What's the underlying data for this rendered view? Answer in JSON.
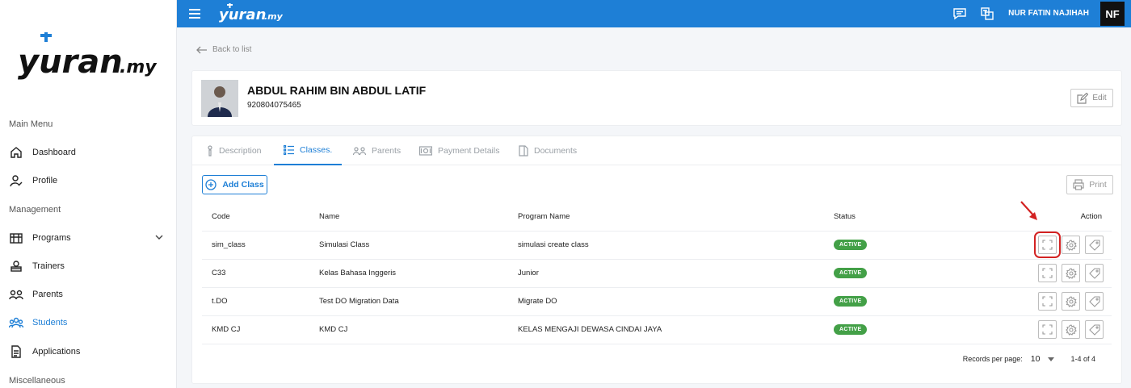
{
  "app": {
    "brand": "Yuran.my",
    "user_name": "NUR FATIN NAJIHAH",
    "user_initials": "NF"
  },
  "sidebar": {
    "sections": [
      {
        "label": "Main Menu"
      },
      {
        "label": "Management"
      },
      {
        "label": "Miscellaneous"
      }
    ],
    "items": [
      {
        "label": "Dashboard",
        "icon": "home-icon"
      },
      {
        "label": "Profile",
        "icon": "profile-icon"
      },
      {
        "label": "Programs",
        "icon": "programs-icon"
      },
      {
        "label": "Trainers",
        "icon": "trainers-icon"
      },
      {
        "label": "Parents",
        "icon": "parents-icon"
      },
      {
        "label": "Students",
        "icon": "students-icon",
        "active": true
      },
      {
        "label": "Applications",
        "icon": "applications-icon"
      }
    ]
  },
  "page": {
    "back_label": "Back to list",
    "student_name": "ABDUL RAHIM BIN ABDUL LATIF",
    "student_id": "920804075465",
    "edit_label": "Edit"
  },
  "tabs": [
    {
      "label": "Description",
      "icon": "description-icon"
    },
    {
      "label": "Classes.",
      "icon": "list-icon",
      "active": true
    },
    {
      "label": "Parents",
      "icon": "parents-icon"
    },
    {
      "label": "Payment Details",
      "icon": "payment-icon"
    },
    {
      "label": "Documents",
      "icon": "document-icon"
    }
  ],
  "toolbar": {
    "add_class_label": "Add Class",
    "print_label": "Print"
  },
  "table": {
    "columns": [
      "Code",
      "Name",
      "Program Name",
      "Status",
      "Action"
    ],
    "rows": [
      {
        "code": "sim_class",
        "name": "Simulasi Class",
        "program": "simulasi create class",
        "status": "ACTIVE"
      },
      {
        "code": "C33",
        "name": "Kelas Bahasa Inggeris",
        "program": "Junior",
        "status": "ACTIVE"
      },
      {
        "code": "t.DO",
        "name": "Test DO Migration Data",
        "program": "Migrate DO",
        "status": "ACTIVE"
      },
      {
        "code": "KMD CJ",
        "name": "KMD CJ",
        "program": "KELAS MENGAJI DEWASA CINDAI JAYA",
        "status": "ACTIVE"
      }
    ],
    "action_icons": [
      "expand-icon",
      "gear-icon",
      "tag-icon"
    ]
  },
  "pagination": {
    "records_label": "Records per page:",
    "per_page": "10",
    "range": "1-4 of 4"
  },
  "colors": {
    "primary": "#1e7fd6",
    "active_badge": "#43a047",
    "highlight": "#d32222"
  }
}
